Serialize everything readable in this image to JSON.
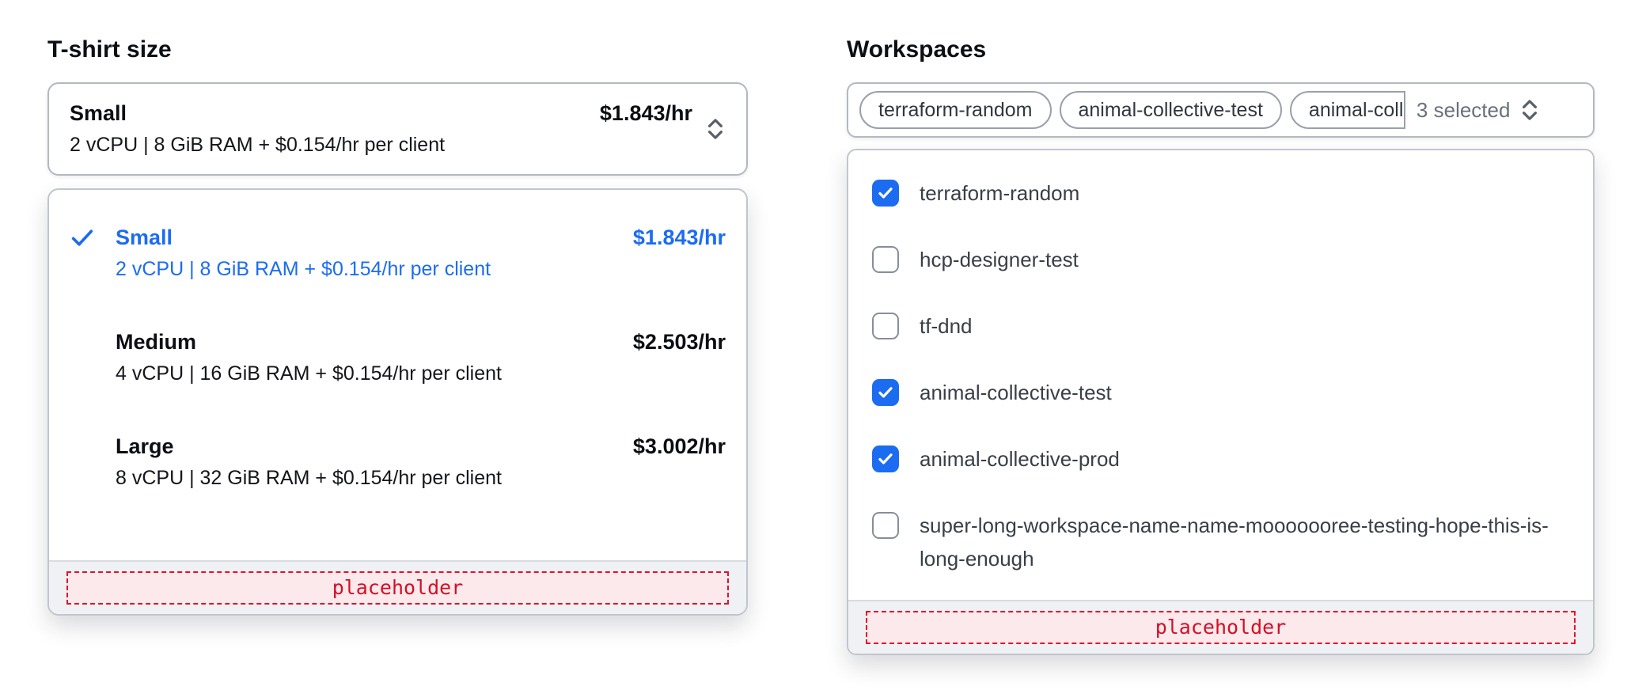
{
  "tshirt": {
    "label": "T-shirt size",
    "trigger": {
      "title": "Small",
      "description": "2 vCPU | 8 GiB RAM + $0.154/hr per client",
      "price": "$1.843/hr"
    },
    "options": [
      {
        "title": "Small",
        "description": "2 vCPU | 8 GiB RAM + $0.154/hr per client",
        "price": "$1.843/hr",
        "selected": true
      },
      {
        "title": "Medium",
        "description": "4 vCPU | 16 GiB RAM + $0.154/hr per client",
        "price": "$2.503/hr",
        "selected": false
      },
      {
        "title": "Large",
        "description": "8 vCPU | 32 GiB RAM + $0.154/hr per client",
        "price": "$3.002/hr",
        "selected": false
      }
    ],
    "footer_placeholder": "placeholder"
  },
  "workspaces": {
    "label": "Workspaces",
    "trigger": {
      "pills": [
        {
          "label": "terraform-random",
          "clipped": false
        },
        {
          "label": "animal-collective-test",
          "clipped": false
        },
        {
          "label": "animal-collective-prod",
          "clipped": true
        }
      ],
      "summary": "3 selected"
    },
    "options": [
      {
        "label": "terraform-random",
        "checked": true
      },
      {
        "label": "hcp-designer-test",
        "checked": false
      },
      {
        "label": "tf-dnd",
        "checked": false
      },
      {
        "label": "animal-collective-test",
        "checked": true
      },
      {
        "label": "animal-collective-prod",
        "checked": true
      },
      {
        "label": "super-long-workspace-name-name-mooooooree-testing-hope-this-is-long-enough",
        "checked": false
      }
    ],
    "footer_placeholder": "placeholder"
  },
  "icons": {
    "trigger": "chevron-up-down-icon",
    "selected_option": "check-icon",
    "checkbox": "check-icon"
  },
  "colors": {
    "accent_blue": "#1c6cf2",
    "placeholder_red": "#e3112b",
    "placeholder_bg": "#fce9ec",
    "footer_bg": "#eff1f4"
  }
}
